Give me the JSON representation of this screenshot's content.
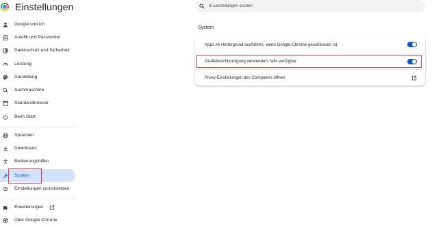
{
  "app": {
    "title": "Einstellungen"
  },
  "search": {
    "placeholder": "In Einstellungen suchen"
  },
  "sidebar": {
    "items": [
      {
        "label": "Google und ich",
        "icon": "person-icon"
      },
      {
        "label": "Autofill und Passwörter",
        "icon": "clipboard-icon"
      },
      {
        "label": "Datenschutz und Sicherheit",
        "icon": "shield-icon"
      },
      {
        "label": "Leistung",
        "icon": "speedometer-icon"
      },
      {
        "label": "Darstellung",
        "icon": "palette-icon"
      },
      {
        "label": "Suchmaschine",
        "icon": "search-icon"
      },
      {
        "label": "Standardbrowser",
        "icon": "browser-icon"
      },
      {
        "label": "Beim Start",
        "icon": "power-icon"
      },
      {
        "label": "Sprachen",
        "icon": "globe-icon"
      },
      {
        "label": "Downloads",
        "icon": "download-icon"
      },
      {
        "label": "Bedienungshilfen",
        "icon": "accessibility-icon"
      },
      {
        "label": "System",
        "icon": "wrench-icon",
        "active": true
      },
      {
        "label": "Einstellungen zurücksetzen",
        "icon": "reset-icon"
      },
      {
        "label": "Erweiterungen",
        "icon": "puzzle-icon"
      },
      {
        "label": "Über Google Chrome",
        "icon": "chrome-icon"
      }
    ]
  },
  "main": {
    "section_title": "System",
    "settings": [
      {
        "label": "Apps im Hintergrund ausführen, wenn Google Chrome geschlossen ist",
        "control": "toggle",
        "enabled": true
      },
      {
        "label": "Grafikbeschleunigung verwenden, falls verfügbar",
        "control": "toggle",
        "enabled": true
      },
      {
        "label": "Proxy-Einstellungen des Computers öffnen",
        "control": "open-in-new",
        "icon": "open-in-new-icon"
      }
    ]
  },
  "colors": {
    "accent": "#0b57d0",
    "active_nav_bg": "#d3e3fd",
    "highlight_border": "#e53935",
    "search_bg": "#f1f3f4"
  }
}
